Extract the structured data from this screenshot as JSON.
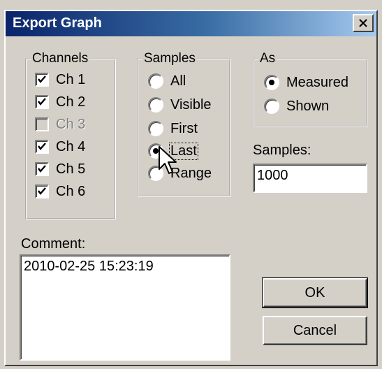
{
  "window": {
    "title": "Export Graph",
    "close_label": "X"
  },
  "channels": {
    "legend": "Channels",
    "items": [
      {
        "label": "Ch 1",
        "checked": true,
        "enabled": true
      },
      {
        "label": "Ch 2",
        "checked": true,
        "enabled": true
      },
      {
        "label": "Ch 3",
        "checked": false,
        "enabled": false
      },
      {
        "label": "Ch 4",
        "checked": true,
        "enabled": true
      },
      {
        "label": "Ch 5",
        "checked": true,
        "enabled": true
      },
      {
        "label": "Ch 6",
        "checked": true,
        "enabled": true
      }
    ]
  },
  "samples_group": {
    "legend": "Samples",
    "options": [
      {
        "label": "All",
        "selected": false
      },
      {
        "label": "Visible",
        "selected": false
      },
      {
        "label": "First",
        "selected": false
      },
      {
        "label": "Last",
        "selected": true
      },
      {
        "label": "Range",
        "selected": false
      }
    ]
  },
  "as_group": {
    "legend": "As",
    "options": [
      {
        "label": "Measured",
        "selected": true
      },
      {
        "label": "Shown",
        "selected": false
      }
    ]
  },
  "samples_field": {
    "label": "Samples:",
    "value": "1000"
  },
  "comment": {
    "label": "Comment:",
    "value": "2010-02-25 15:23:19"
  },
  "buttons": {
    "ok": "OK",
    "cancel": "Cancel"
  },
  "colors": {
    "title_gradient_start": "#0a246a",
    "title_gradient_end": "#a6caf0",
    "face": "#d4d0c8"
  }
}
